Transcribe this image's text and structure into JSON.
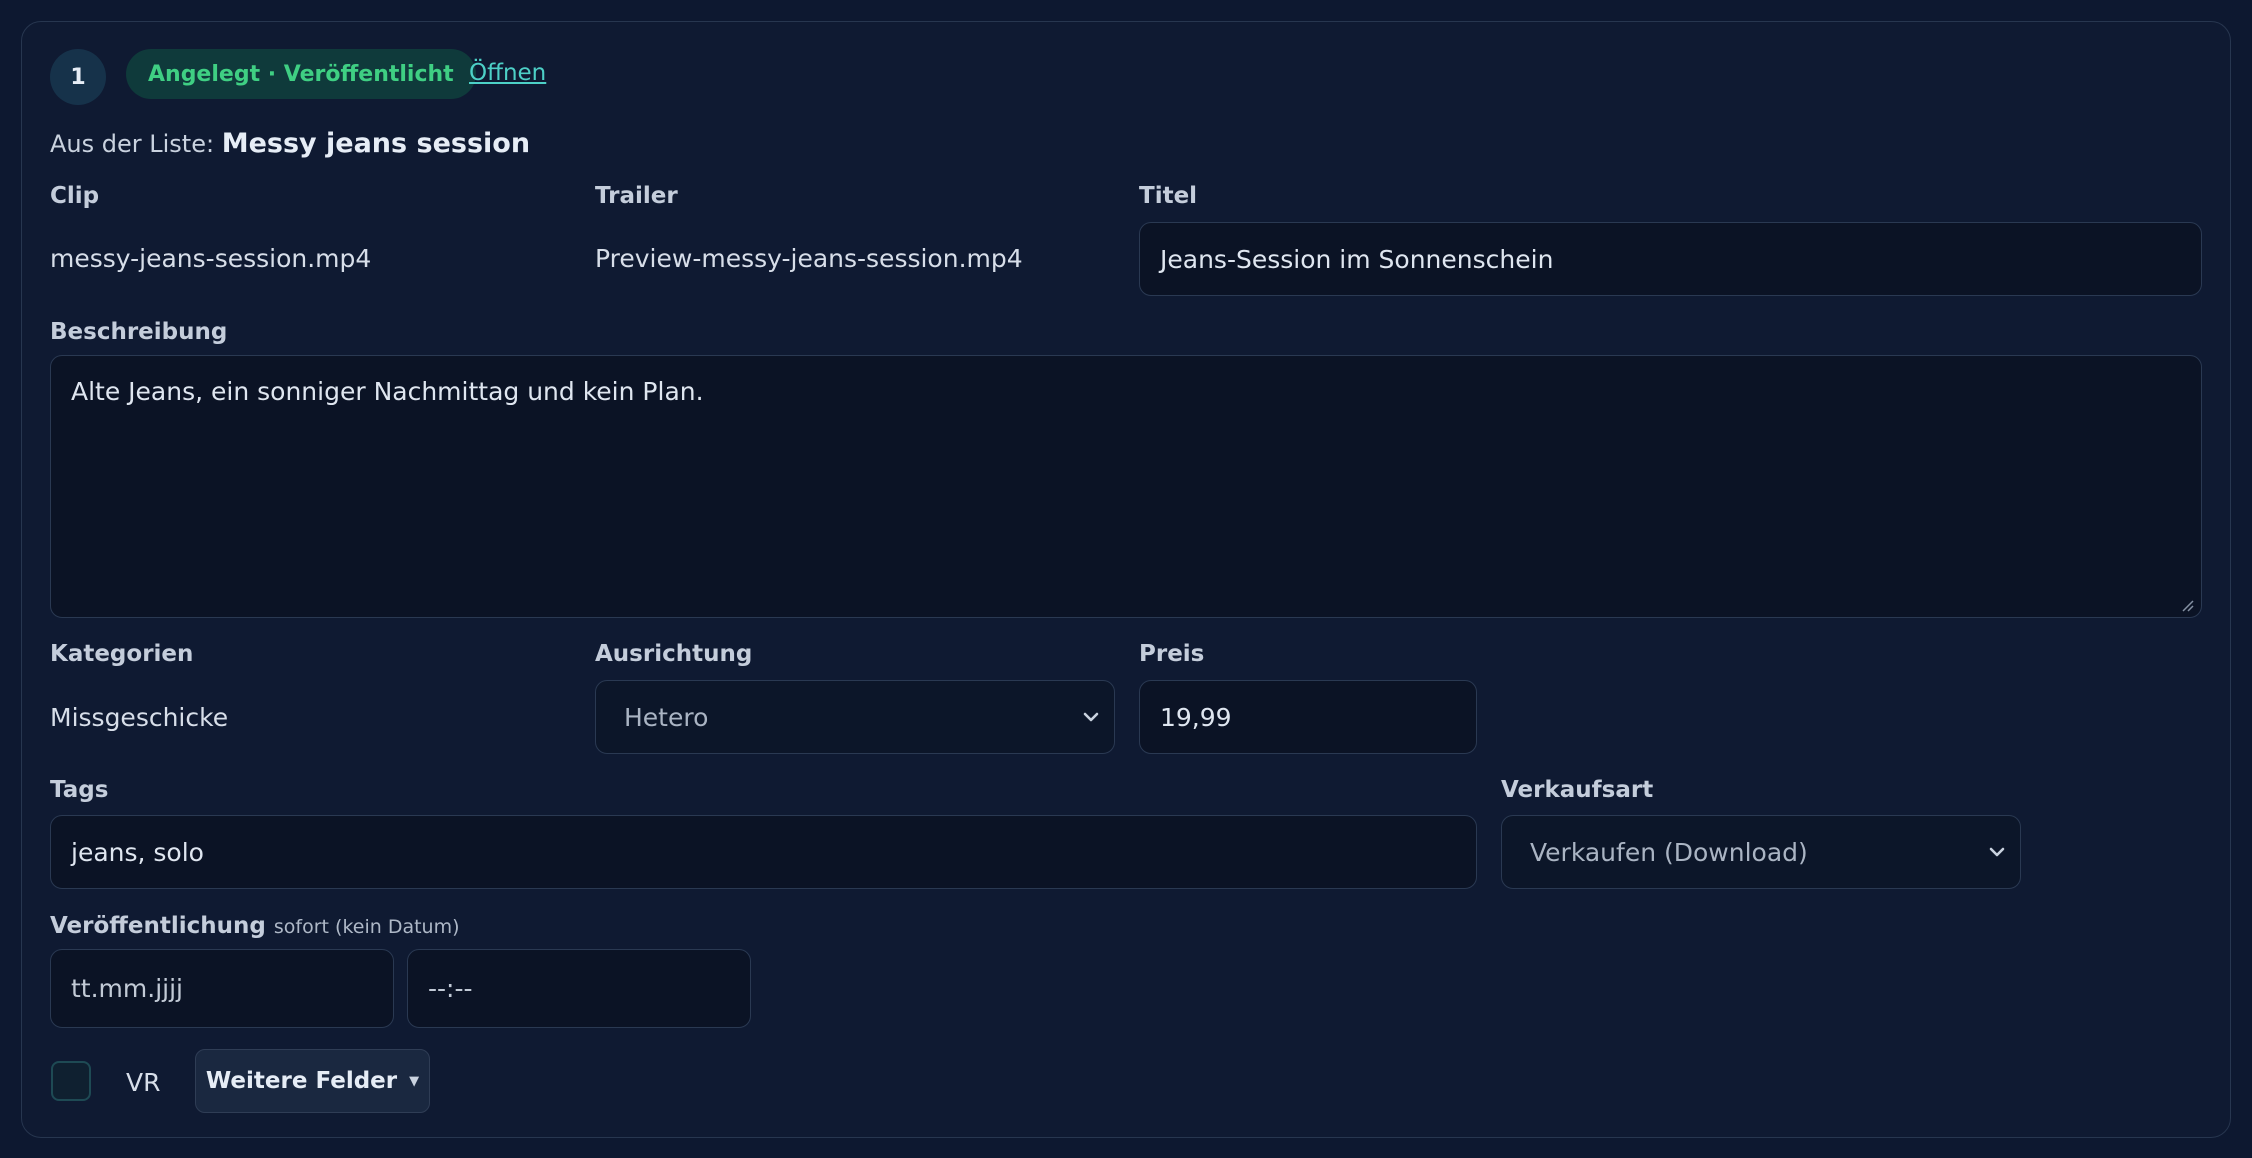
{
  "item": {
    "index": "1",
    "status": "Angelegt · Veröffentlicht",
    "open_link": "Öffnen",
    "source_prefix": "Aus der Liste:",
    "source_name": "Messy jeans session"
  },
  "labels": {
    "clip": "Clip",
    "trailer": "Trailer",
    "title": "Titel",
    "description": "Beschreibung",
    "categories": "Kategorien",
    "orientation": "Ausrichtung",
    "price": "Preis",
    "tags": "Tags",
    "sale_type": "Verkaufsart",
    "publication": "Veröffentlichung",
    "publication_hint": "sofort (kein Datum)",
    "vr": "VR",
    "more_fields": "Weitere Felder"
  },
  "values": {
    "clip": "messy-jeans-session.mp4",
    "trailer": "Preview-messy-jeans-session.mp4",
    "title": "Jeans-Session im Sonnenschein",
    "description": "Alte Jeans, ein sonniger Nachmittag und kein Plan.",
    "categories": "Missgeschicke",
    "orientation": "Hetero",
    "price": "19,99",
    "tags": "jeans, solo",
    "sale_type": "Verkaufen (Download)",
    "date_placeholder": "tt.mm.jjjj",
    "time_placeholder": "--:--",
    "vr_checked": false
  },
  "icons": {
    "select_chevron": "chevron-down-icon",
    "more_caret": "caret-down-icon"
  },
  "colors": {
    "background": "#0d1830",
    "status_text": "#3fcf83",
    "link": "#4dd0c7"
  }
}
